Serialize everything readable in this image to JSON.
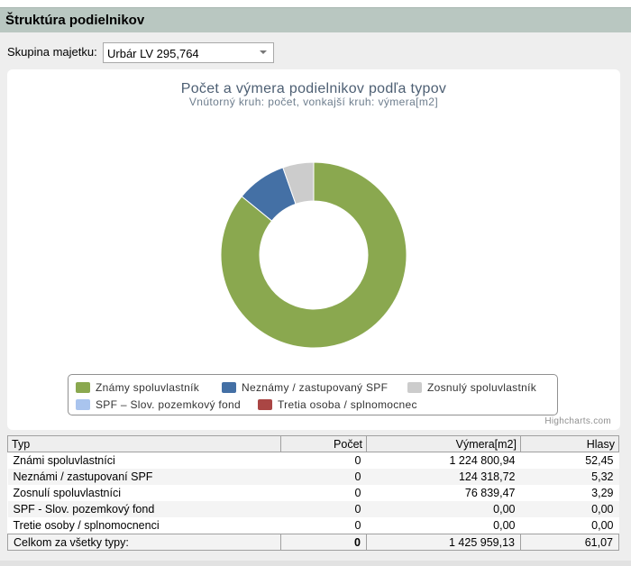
{
  "header": {
    "title": "Štruktúra podielnikov"
  },
  "filter": {
    "label": "Skupina majetku:",
    "selected": "Urbár LV 295,764"
  },
  "chart_data": {
    "type": "pie",
    "title": "Počet a výmera podielnikov podľa typov",
    "subtitle": "Vnútorný kruh: počet, vonkajší kruh: výmera[m2]",
    "series": [
      {
        "name": "Známy spoluvlastník",
        "value": 1224800.94,
        "color": "#8aa84f"
      },
      {
        "name": "Neznámy / zastupovaný SPF",
        "value": 124318.72,
        "color": "#4470a5"
      },
      {
        "name": "Zosnulý spoluvlastník",
        "value": 76839.47,
        "color": "#cccccc"
      },
      {
        "name": "SPF – Slov. pozemkový fond",
        "value": 0,
        "color": "#a9c4ee"
      },
      {
        "name": "Tretia osoba / splnomocnec",
        "value": 0,
        "color": "#aa4644"
      }
    ],
    "credits": "Highcharts.com"
  },
  "table": {
    "headers": [
      "Typ",
      "Počet",
      "Výmera[m2]",
      "Hlasy"
    ],
    "rows": [
      [
        "Známi spoluvlastníci",
        "0",
        "1 224 800,94",
        "52,45"
      ],
      [
        "Neznámi / zastupovaní SPF",
        "0",
        "124 318,72",
        "5,32"
      ],
      [
        "Zosnulí spoluvlastníci",
        "0",
        "76 839,47",
        "3,29"
      ],
      [
        "SPF - Slov. pozemkový fond",
        "0",
        "0,00",
        "0,00"
      ],
      [
        "Tretie osoby / splnomocnenci",
        "0",
        "0,00",
        "0,00"
      ]
    ],
    "total": [
      "Celkom za všetky typy:",
      "0",
      "1 425 959,13",
      "61,07"
    ]
  }
}
